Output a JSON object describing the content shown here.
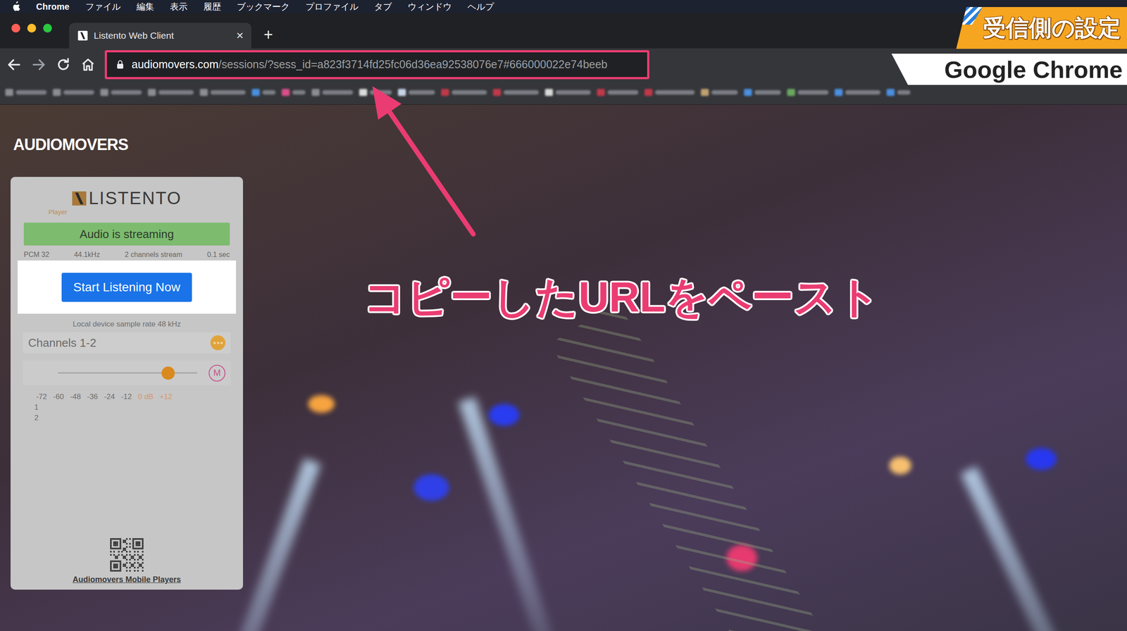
{
  "menu_bar": {
    "app": "Chrome",
    "items": [
      "ファイル",
      "編集",
      "表示",
      "履歴",
      "ブックマーク",
      "プロファイル",
      "タブ",
      "ウィンドウ",
      "ヘルプ"
    ]
  },
  "tabs": [
    {
      "label": "Listento Web Client",
      "selected": true,
      "close": "×"
    }
  ],
  "new_tab": "+",
  "address_bar": {
    "host": "audiomovers.com",
    "path": "/sessions/?sess_id=a823f3714fd25fc06d36ea92538076e7#666000022e74beeb",
    "highlighted": true
  },
  "page": {
    "logo": "AUDIOMOVERS",
    "player": {
      "brand": "LISTENTO",
      "sub": "Player",
      "status": "Audio is streaming",
      "stream_info": [
        "PCM 32",
        "44.1kHz",
        "2 channels stream",
        "0.1 sec"
      ],
      "button": "Start Listening Now",
      "sample_rate": "Local device sample rate 48 kHz",
      "channel_group": "Channels 1-2",
      "volume": {
        "level": 0.79
      },
      "mute": {
        "label": "M",
        "on": false
      },
      "meter_scale": [
        {
          "label": "-72",
          "color": "#6e6e6e"
        },
        {
          "label": "-60",
          "color": "#6e6e6e"
        },
        {
          "label": "-48",
          "color": "#6e6e6e"
        },
        {
          "label": "-36",
          "color": "#6e6e6e"
        },
        {
          "label": "-24",
          "color": "#6e6e6e"
        },
        {
          "label": "-12",
          "color": "#6e6e6e"
        },
        {
          "label": "0 dB",
          "color": "#d9946a"
        },
        {
          "label": "+12",
          "color": "#d9946a"
        }
      ],
      "meter_channels": [
        {
          "label": "1",
          "level": 0
        },
        {
          "label": "2",
          "level": 0
        }
      ],
      "mobile_link": "Audiomovers Mobile Players"
    }
  },
  "annotations": {
    "badge": "受信側の設定",
    "browser_label": "Google Chrome",
    "callout": "コピーしたURLをペースト"
  }
}
